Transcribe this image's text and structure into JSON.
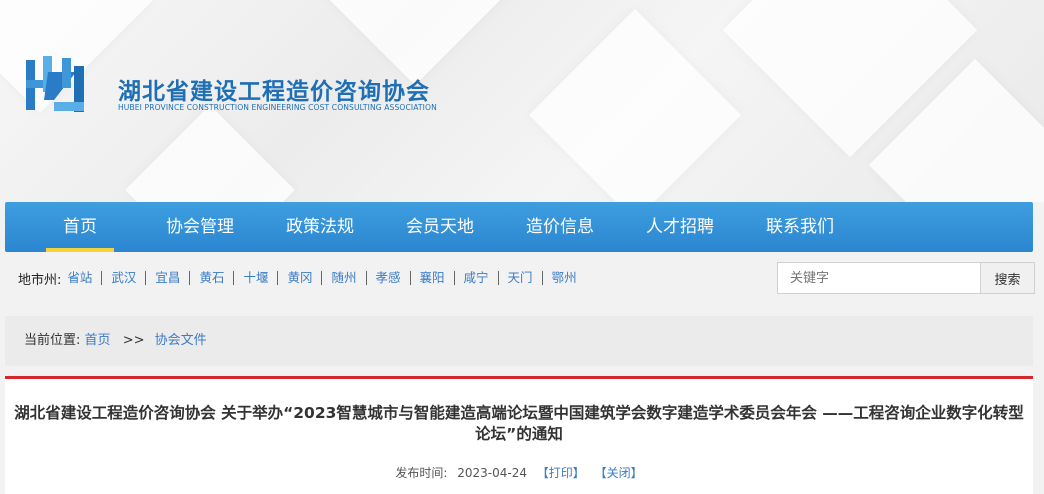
{
  "header": {
    "title": "湖北省建设工程造价咨询协会",
    "subtitle": "HUBEI PROVINCE CONSTRUCTION ENGINEERING COST CONSULTING ASSOCIATION",
    "brand_color": "#1f6fb5"
  },
  "nav": {
    "items": [
      {
        "label": "首页",
        "active": true
      },
      {
        "label": "协会管理"
      },
      {
        "label": "政策法规"
      },
      {
        "label": "会员天地"
      },
      {
        "label": "造价信息"
      },
      {
        "label": "人才招聘"
      },
      {
        "label": "联系我们"
      }
    ],
    "bg_color": "#2b86cf",
    "active_underline_color": "#f5d33b"
  },
  "cities": {
    "label": "地市州:",
    "items": [
      "省站",
      "武汉",
      "宜昌",
      "黄石",
      "十堰",
      "黄冈",
      "随州",
      "孝感",
      "襄阳",
      "咸宁",
      "天门",
      "鄂州"
    ]
  },
  "search": {
    "placeholder": "关键字",
    "button_label": "搜索"
  },
  "breadcrumb": {
    "label": "当前位置:",
    "home": "首页",
    "separator": ">>",
    "current": "协会文件"
  },
  "article": {
    "title": "湖北省建设工程造价咨询协会 关于举办“2023智慧城市与智能建造高端论坛暨中国建筑学会数字建造学术委员会年会 ——工程咨询企业数字化转型论坛”的通知",
    "date_label": "发布时间:",
    "date": "2023-04-24",
    "print_label": "【打印】",
    "close_label": "【关闭】",
    "accent_color": "#d8262d"
  },
  "icons": {
    "logo": "hz-logo-icon"
  }
}
